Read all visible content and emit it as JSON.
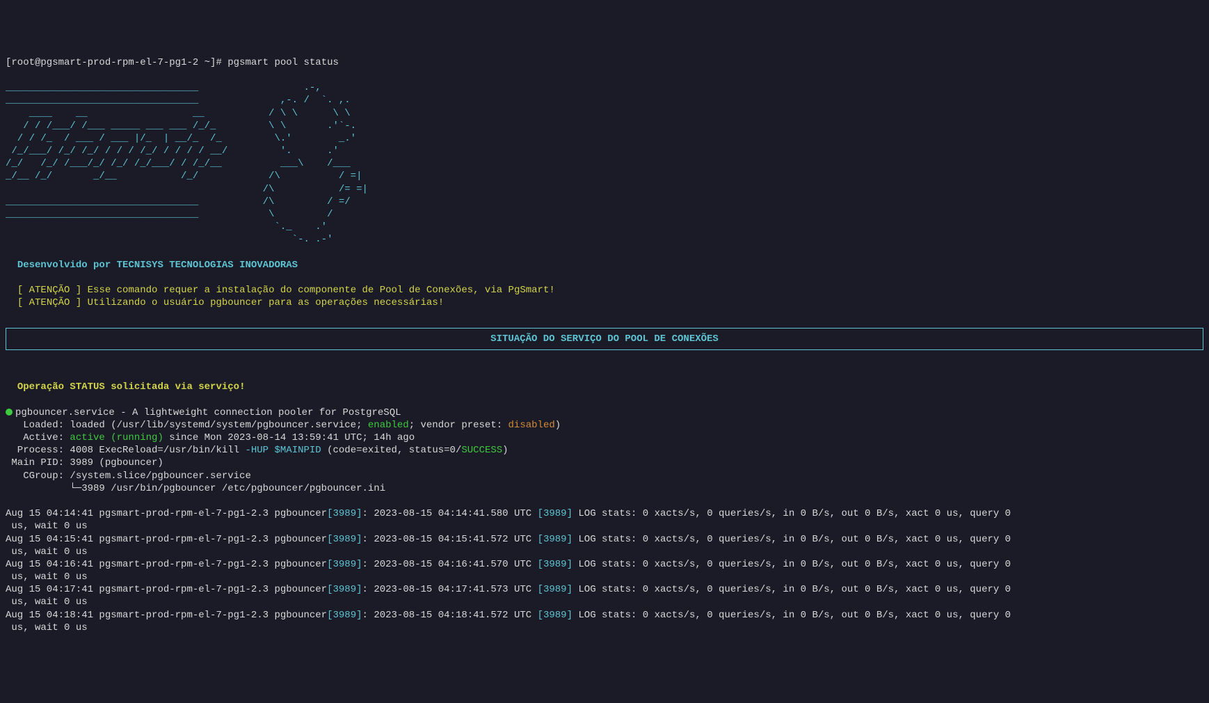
{
  "prompt": {
    "prefix": "[root@pgsmart-prod-rpm-el-7-pg1-2 ~]# ",
    "cmd": "pgsmart pool status"
  },
  "ascii": "_________________________________                  .-,\n_________________________________              ,-. /  `. ,.\n    ____    __                  __           / \\ \\      \\ \\\n   / / /___/ /___ _____ ___ ___ /_/_         \\ \\       .'`-.\n  / / /_  / ___ / ___ |/_  | __/_  /_         \\.'        _.'\n /_/___/ /_/ /_/ / / / /_/ / / / / __/         '.      .'\n/_/   /_/ /___/_/ /_/ /_/___/ / /_/__          ___\\    /___\n_/__ /_/       _/__           /_/            /\\          / =|\n                                            /\\           /= =|\n_________________________________           /\\         / =/\n_________________________________            \\         /\n                                              `._    .'\n                                                 `-. .-'",
  "dev": "Desenvolvido por TECNISYS TECNOLOGIAS INOVADORAS",
  "warn": {
    "tag1": "[ ATENÇÃO ] ",
    "msg1": "Esse comando requer a instalação do componente de Pool de Conexões, via PgSmart!",
    "tag2": "[ ATENÇÃO ] ",
    "msg2": "Utilizando o usuário pgbouncer para as operações necessárias!"
  },
  "box_title": "SITUAÇÃO DO SERVIÇO DO POOL DE CONEXÕES",
  "status_line": "Operação STATUS solicitada via serviço!",
  "svc": {
    "name": "pgbouncer.service - A lightweight connection pooler for PostgreSQL",
    "loaded_pre": "   Loaded: loaded (/usr/lib/systemd/system/pgbouncer.service; ",
    "enabled": "enabled",
    "loaded_mid": "; vendor preset: ",
    "disabled": "disabled",
    "loaded_post": ")",
    "active_pre": "   Active: ",
    "active": "active (running)",
    "active_post": " since Mon 2023-08-14 13:59:41 UTC; 14h ago",
    "proc_pre": "  Process: 4008 ExecReload=/usr/bin/kill ",
    "proc_hup": "-HUP ",
    "proc_pid": "$MAINPID",
    "proc_mid": " (code=",
    "proc_exited": "exited",
    "proc_mid2": ", status=0/",
    "proc_success": "SUCCESS",
    "proc_post": ")",
    "mainpid": " Main PID: 3989 (pgbouncer)",
    "cgroup1": "   CGroup: /system.slice/pgbouncer.service",
    "cgroup2": "           └─3989 /usr/bin/pgbouncer /etc/pgbouncer/pgbouncer.ini"
  },
  "log": {
    "host": " pgsmart-prod-rpm-el-7-pg1-2.3 pgbouncer",
    "pid_br": "[3989]",
    "tail": " LOG stats: 0 xacts/s, 0 queries/s, in 0 B/s, out 0 B/s, xact 0 us, query 0\n us, wait 0 us",
    "rows": [
      {
        "ts1": "Aug 15 04:14:41",
        "utc": ": 2023-08-15 04:14:41.580 UTC "
      },
      {
        "ts1": "Aug 15 04:15:41",
        "utc": ": 2023-08-15 04:15:41.572 UTC "
      },
      {
        "ts1": "Aug 15 04:16:41",
        "utc": ": 2023-08-15 04:16:41.570 UTC "
      },
      {
        "ts1": "Aug 15 04:17:41",
        "utc": ": 2023-08-15 04:17:41.573 UTC "
      },
      {
        "ts1": "Aug 15 04:18:41",
        "utc": ": 2023-08-15 04:18:41.572 UTC "
      }
    ]
  }
}
